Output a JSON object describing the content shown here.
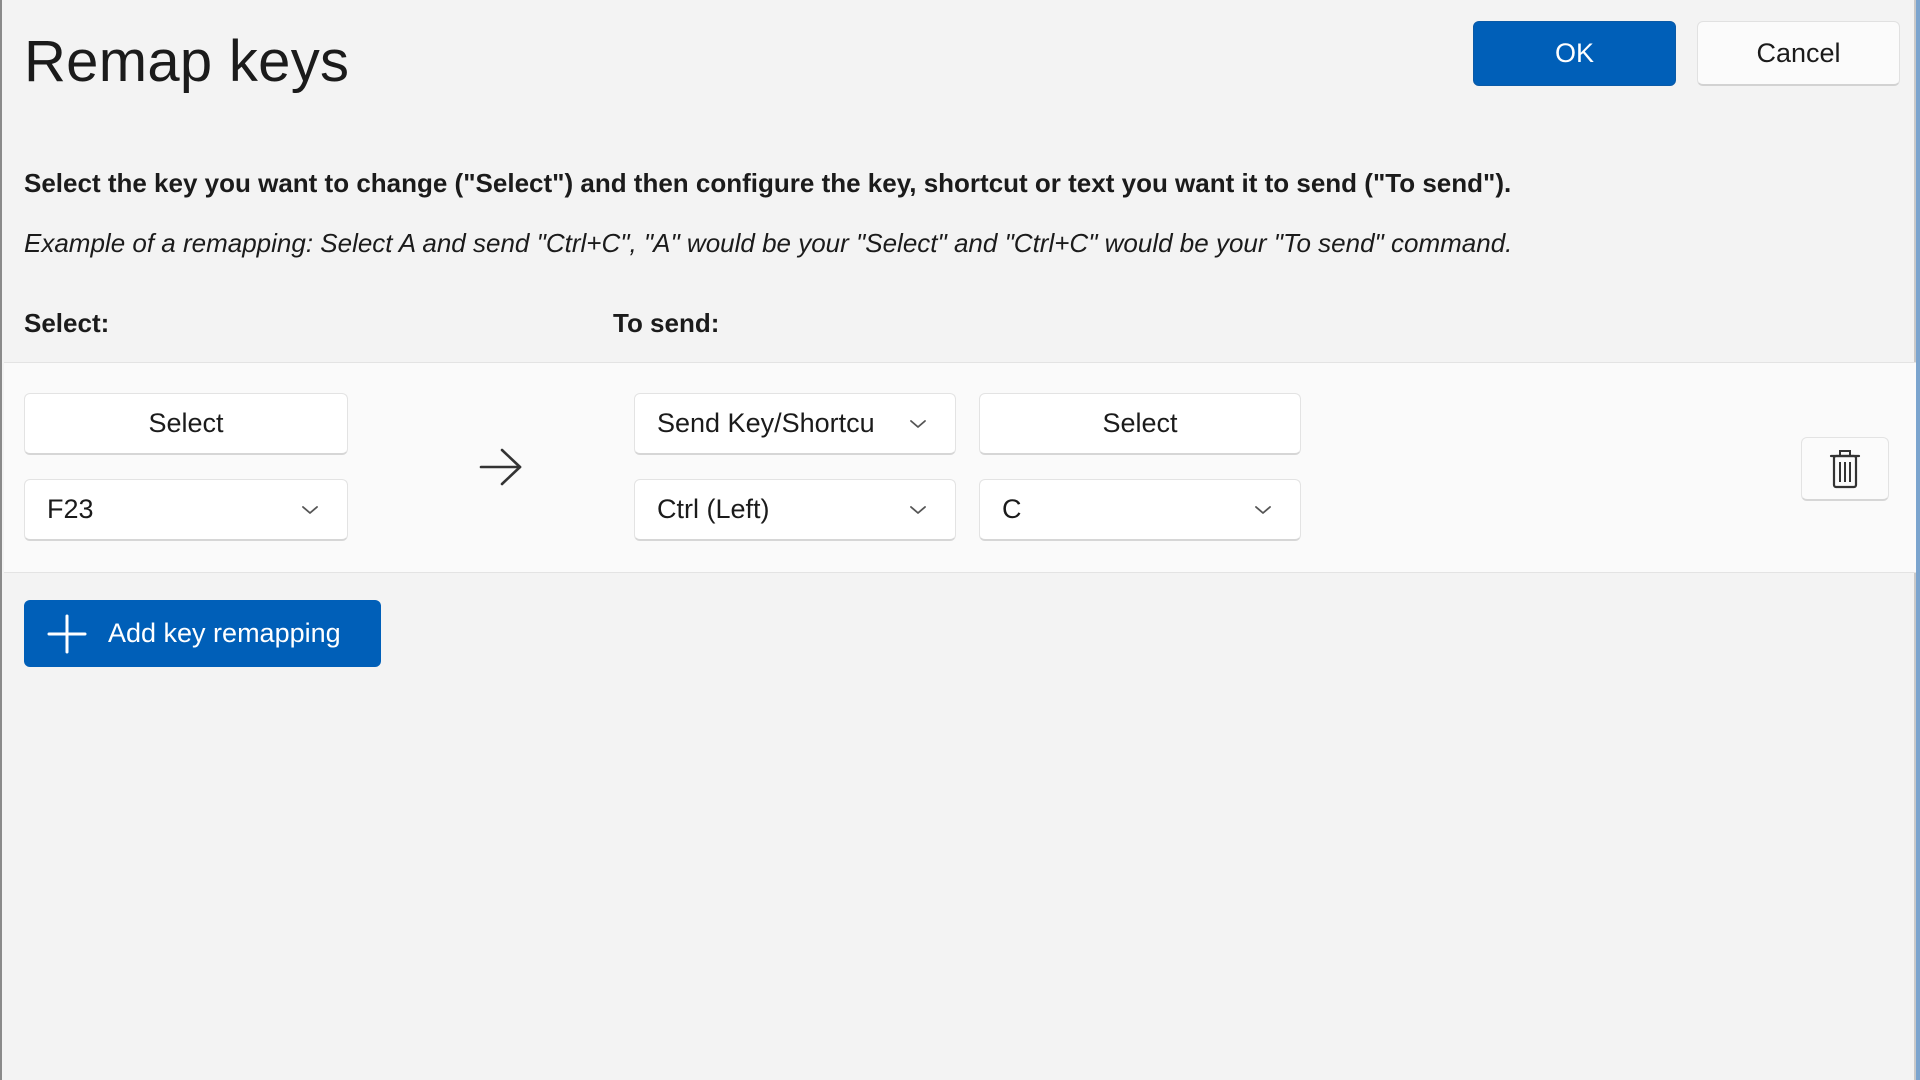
{
  "dialog": {
    "title": "Remap keys",
    "ok_label": "OK",
    "cancel_label": "Cancel"
  },
  "instructions": {
    "main": "Select the key you want to change (\"Select\") and then configure the key, shortcut or text you want it to send (\"To send\").",
    "example": "Example of a remapping: Select A and send \"Ctrl+C\", \"A\" would be your \"Select\" and \"Ctrl+C\" would be your \"To send\" command."
  },
  "columns": {
    "select_header": "Select:",
    "send_header": "To send:"
  },
  "mapping_row": {
    "select_button_label": "Select",
    "select_key_value": "F23",
    "send_type_value": "Send Key/Shortcu",
    "send_select_button_label": "Select",
    "send_modifier_value": "Ctrl (Left)",
    "send_key_value": "C"
  },
  "add_button_label": "Add key remapping",
  "colors": {
    "accent": "#005fb8",
    "background": "#f3f3f3",
    "row_background": "#fafafa"
  },
  "icons": {
    "arrow": "arrow-right-icon",
    "delete": "trash-icon",
    "add": "plus-icon",
    "dropdown": "chevron-down-icon"
  }
}
